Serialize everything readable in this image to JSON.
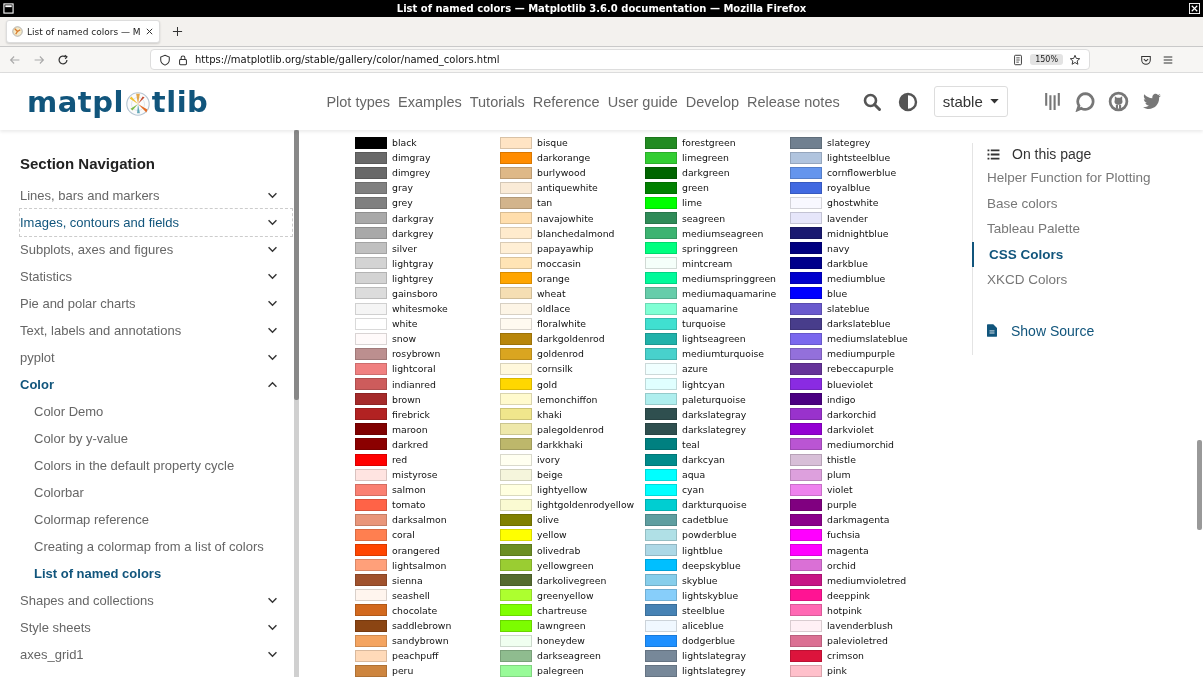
{
  "window": {
    "title": "List of named colors — Matplotlib 3.6.0 documentation — Mozilla Firefox"
  },
  "browser": {
    "tabs": [
      {
        "label": "List of named colors — M",
        "selected": true
      }
    ],
    "url": "https://matplotlib.org/stable/gallery/color/named_colors.html",
    "zoom": "150%"
  },
  "site": {
    "logo": {
      "before": "matpl",
      "after": "tlib"
    },
    "nav": [
      "Plot types",
      "Examples",
      "Tutorials",
      "Reference",
      "User guide",
      "Develop",
      "Release notes"
    ],
    "version": "stable"
  },
  "sidebar": {
    "title": "Section Navigation",
    "items": [
      {
        "label": "Lines, bars and markers",
        "expanded": false,
        "active": false,
        "focused": false
      },
      {
        "label": "Images, contours and fields",
        "expanded": false,
        "active": false,
        "focused": true
      },
      {
        "label": "Subplots, axes and figures",
        "expanded": false,
        "active": false,
        "focused": false
      },
      {
        "label": "Statistics",
        "expanded": false,
        "active": false,
        "focused": false
      },
      {
        "label": "Pie and polar charts",
        "expanded": false,
        "active": false,
        "focused": false
      },
      {
        "label": "Text, labels and annotations",
        "expanded": false,
        "active": false,
        "focused": false
      },
      {
        "label": "pyplot",
        "expanded": false,
        "active": false,
        "focused": false
      },
      {
        "label": "Color",
        "expanded": true,
        "active": true,
        "focused": false,
        "children": [
          {
            "label": "Color Demo",
            "selected": false
          },
          {
            "label": "Color by y-value",
            "selected": false
          },
          {
            "label": "Colors in the default property cycle",
            "selected": false
          },
          {
            "label": "Colorbar",
            "selected": false
          },
          {
            "label": "Colormap reference",
            "selected": false
          },
          {
            "label": "Creating a colormap from a list of colors",
            "selected": false
          },
          {
            "label": "List of named colors",
            "selected": true
          }
        ]
      },
      {
        "label": "Shapes and collections",
        "expanded": false,
        "active": false,
        "focused": false
      },
      {
        "label": "Style sheets",
        "expanded": false,
        "active": false,
        "focused": false
      },
      {
        "label": "axes_grid1",
        "expanded": false,
        "active": false,
        "focused": false
      }
    ]
  },
  "swatches": {
    "columns": [
      [
        {
          "name": "black",
          "color": "#000000"
        },
        {
          "name": "dimgray",
          "color": "#696969"
        },
        {
          "name": "dimgrey",
          "color": "#696969"
        },
        {
          "name": "gray",
          "color": "#808080"
        },
        {
          "name": "grey",
          "color": "#808080"
        },
        {
          "name": "darkgray",
          "color": "#a9a9a9"
        },
        {
          "name": "darkgrey",
          "color": "#a9a9a9"
        },
        {
          "name": "silver",
          "color": "#c0c0c0"
        },
        {
          "name": "lightgray",
          "color": "#d3d3d3"
        },
        {
          "name": "lightgrey",
          "color": "#d3d3d3"
        },
        {
          "name": "gainsboro",
          "color": "#dcdcdc"
        },
        {
          "name": "whitesmoke",
          "color": "#f5f5f5"
        },
        {
          "name": "white",
          "color": "#ffffff"
        },
        {
          "name": "snow",
          "color": "#fffafa"
        },
        {
          "name": "rosybrown",
          "color": "#bc8f8f"
        },
        {
          "name": "lightcoral",
          "color": "#f08080"
        },
        {
          "name": "indianred",
          "color": "#cd5c5c"
        },
        {
          "name": "brown",
          "color": "#a52a2a"
        },
        {
          "name": "firebrick",
          "color": "#b22222"
        },
        {
          "name": "maroon",
          "color": "#800000"
        },
        {
          "name": "darkred",
          "color": "#8b0000"
        },
        {
          "name": "red",
          "color": "#ff0000"
        },
        {
          "name": "mistyrose",
          "color": "#ffe4e1"
        },
        {
          "name": "salmon",
          "color": "#fa8072"
        },
        {
          "name": "tomato",
          "color": "#ff6347"
        },
        {
          "name": "darksalmon",
          "color": "#e9967a"
        },
        {
          "name": "coral",
          "color": "#ff7f50"
        },
        {
          "name": "orangered",
          "color": "#ff4500"
        },
        {
          "name": "lightsalmon",
          "color": "#ffa07a"
        },
        {
          "name": "sienna",
          "color": "#a0522d"
        },
        {
          "name": "seashell",
          "color": "#fff5ee"
        },
        {
          "name": "chocolate",
          "color": "#d2691e"
        },
        {
          "name": "saddlebrown",
          "color": "#8b4513"
        },
        {
          "name": "sandybrown",
          "color": "#f4a460"
        },
        {
          "name": "peachpuff",
          "color": "#ffdab9"
        },
        {
          "name": "peru",
          "color": "#cd853f"
        }
      ],
      [
        {
          "name": "bisque",
          "color": "#ffe4c4"
        },
        {
          "name": "darkorange",
          "color": "#ff8c00"
        },
        {
          "name": "burlywood",
          "color": "#deb887"
        },
        {
          "name": "antiquewhite",
          "color": "#faebd7"
        },
        {
          "name": "tan",
          "color": "#d2b48c"
        },
        {
          "name": "navajowhite",
          "color": "#ffdead"
        },
        {
          "name": "blanchedalmond",
          "color": "#ffebcd"
        },
        {
          "name": "papayawhip",
          "color": "#ffefd5"
        },
        {
          "name": "moccasin",
          "color": "#ffe4b5"
        },
        {
          "name": "orange",
          "color": "#ffa500"
        },
        {
          "name": "wheat",
          "color": "#f5deb3"
        },
        {
          "name": "oldlace",
          "color": "#fdf5e6"
        },
        {
          "name": "floralwhite",
          "color": "#fffaf0"
        },
        {
          "name": "darkgoldenrod",
          "color": "#b8860b"
        },
        {
          "name": "goldenrod",
          "color": "#daa520"
        },
        {
          "name": "cornsilk",
          "color": "#fff8dc"
        },
        {
          "name": "gold",
          "color": "#ffd700"
        },
        {
          "name": "lemonchiffon",
          "color": "#fffacd"
        },
        {
          "name": "khaki",
          "color": "#f0e68c"
        },
        {
          "name": "palegoldenrod",
          "color": "#eee8aa"
        },
        {
          "name": "darkkhaki",
          "color": "#bdb76b"
        },
        {
          "name": "ivory",
          "color": "#fffff0"
        },
        {
          "name": "beige",
          "color": "#f5f5dc"
        },
        {
          "name": "lightyellow",
          "color": "#ffffe0"
        },
        {
          "name": "lightgoldenrodyellow",
          "color": "#fafad2"
        },
        {
          "name": "olive",
          "color": "#808000"
        },
        {
          "name": "yellow",
          "color": "#ffff00"
        },
        {
          "name": "olivedrab",
          "color": "#6b8e23"
        },
        {
          "name": "yellowgreen",
          "color": "#9acd32"
        },
        {
          "name": "darkolivegreen",
          "color": "#556b2f"
        },
        {
          "name": "greenyellow",
          "color": "#adff2f"
        },
        {
          "name": "chartreuse",
          "color": "#7fff00"
        },
        {
          "name": "lawngreen",
          "color": "#7cfc00"
        },
        {
          "name": "honeydew",
          "color": "#f0fff0"
        },
        {
          "name": "darkseagreen",
          "color": "#8fbc8f"
        },
        {
          "name": "palegreen",
          "color": "#98fb98"
        }
      ],
      [
        {
          "name": "forestgreen",
          "color": "#228b22"
        },
        {
          "name": "limegreen",
          "color": "#32cd32"
        },
        {
          "name": "darkgreen",
          "color": "#006400"
        },
        {
          "name": "green",
          "color": "#008000"
        },
        {
          "name": "lime",
          "color": "#00ff00"
        },
        {
          "name": "seagreen",
          "color": "#2e8b57"
        },
        {
          "name": "mediumseagreen",
          "color": "#3cb371"
        },
        {
          "name": "springgreen",
          "color": "#00ff7f"
        },
        {
          "name": "mintcream",
          "color": "#f5fffa"
        },
        {
          "name": "mediumspringgreen",
          "color": "#00fa9a"
        },
        {
          "name": "mediumaquamarine",
          "color": "#66cdaa"
        },
        {
          "name": "aquamarine",
          "color": "#7fffd4"
        },
        {
          "name": "turquoise",
          "color": "#40e0d0"
        },
        {
          "name": "lightseagreen",
          "color": "#20b2aa"
        },
        {
          "name": "mediumturquoise",
          "color": "#48d1cc"
        },
        {
          "name": "azure",
          "color": "#f0ffff"
        },
        {
          "name": "lightcyan",
          "color": "#e0ffff"
        },
        {
          "name": "paleturquoise",
          "color": "#afeeee"
        },
        {
          "name": "darkslategray",
          "color": "#2f4f4f"
        },
        {
          "name": "darkslategrey",
          "color": "#2f4f4f"
        },
        {
          "name": "teal",
          "color": "#008080"
        },
        {
          "name": "darkcyan",
          "color": "#008b8b"
        },
        {
          "name": "aqua",
          "color": "#00ffff"
        },
        {
          "name": "cyan",
          "color": "#00ffff"
        },
        {
          "name": "darkturquoise",
          "color": "#00ced1"
        },
        {
          "name": "cadetblue",
          "color": "#5f9ea0"
        },
        {
          "name": "powderblue",
          "color": "#b0e0e6"
        },
        {
          "name": "lightblue",
          "color": "#add8e6"
        },
        {
          "name": "deepskyblue",
          "color": "#00bfff"
        },
        {
          "name": "skyblue",
          "color": "#87ceeb"
        },
        {
          "name": "lightskyblue",
          "color": "#87cefa"
        },
        {
          "name": "steelblue",
          "color": "#4682b4"
        },
        {
          "name": "aliceblue",
          "color": "#f0f8ff"
        },
        {
          "name": "dodgerblue",
          "color": "#1e90ff"
        },
        {
          "name": "lightslategray",
          "color": "#778899"
        },
        {
          "name": "lightslategrey",
          "color": "#778899"
        }
      ],
      [
        {
          "name": "slategrey",
          "color": "#708090"
        },
        {
          "name": "lightsteelblue",
          "color": "#b0c4de"
        },
        {
          "name": "cornflowerblue",
          "color": "#6495ed"
        },
        {
          "name": "royalblue",
          "color": "#4169e1"
        },
        {
          "name": "ghostwhite",
          "color": "#f8f8ff"
        },
        {
          "name": "lavender",
          "color": "#e6e6fa"
        },
        {
          "name": "midnightblue",
          "color": "#191970"
        },
        {
          "name": "navy",
          "color": "#000080"
        },
        {
          "name": "darkblue",
          "color": "#00008b"
        },
        {
          "name": "mediumblue",
          "color": "#0000cd"
        },
        {
          "name": "blue",
          "color": "#0000ff"
        },
        {
          "name": "slateblue",
          "color": "#6a5acd"
        },
        {
          "name": "darkslateblue",
          "color": "#483d8b"
        },
        {
          "name": "mediumslateblue",
          "color": "#7b68ee"
        },
        {
          "name": "mediumpurple",
          "color": "#9370db"
        },
        {
          "name": "rebeccapurple",
          "color": "#663399"
        },
        {
          "name": "blueviolet",
          "color": "#8a2be2"
        },
        {
          "name": "indigo",
          "color": "#4b0082"
        },
        {
          "name": "darkorchid",
          "color": "#9932cc"
        },
        {
          "name": "darkviolet",
          "color": "#9400d3"
        },
        {
          "name": "mediumorchid",
          "color": "#ba55d3"
        },
        {
          "name": "thistle",
          "color": "#d8bfd8"
        },
        {
          "name": "plum",
          "color": "#dda0dd"
        },
        {
          "name": "violet",
          "color": "#ee82ee"
        },
        {
          "name": "purple",
          "color": "#800080"
        },
        {
          "name": "darkmagenta",
          "color": "#8b008b"
        },
        {
          "name": "fuchsia",
          "color": "#ff00ff"
        },
        {
          "name": "magenta",
          "color": "#ff00ff"
        },
        {
          "name": "orchid",
          "color": "#da70d6"
        },
        {
          "name": "mediumvioletred",
          "color": "#c71585"
        },
        {
          "name": "deeppink",
          "color": "#ff1493"
        },
        {
          "name": "hotpink",
          "color": "#ff69b4"
        },
        {
          "name": "lavenderblush",
          "color": "#fff0f5"
        },
        {
          "name": "palevioletred",
          "color": "#db7093"
        },
        {
          "name": "crimson",
          "color": "#dc143c"
        },
        {
          "name": "pink",
          "color": "#ffc0cb"
        }
      ]
    ]
  },
  "toc": {
    "title": "On this page",
    "items": [
      {
        "label": "Helper Function for Plotting",
        "selected": false
      },
      {
        "label": "Base colors",
        "selected": false
      },
      {
        "label": "Tableau Palette",
        "selected": false
      },
      {
        "label": "CSS Colors",
        "selected": true
      },
      {
        "label": "XKCD Colors",
        "selected": false
      }
    ],
    "show_source": "Show Source"
  }
}
